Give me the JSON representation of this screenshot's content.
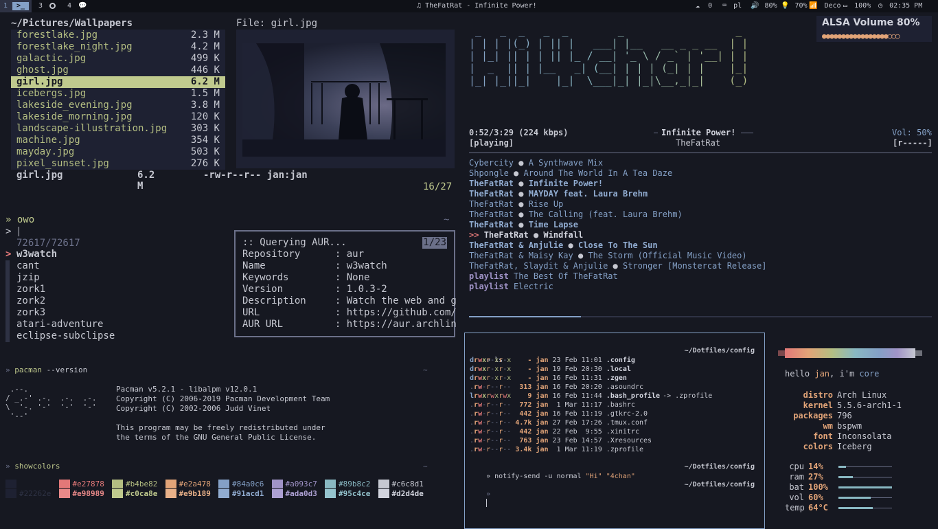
{
  "topbar": {
    "ws2": "3",
    "ws3": "4",
    "now_playing": "TheFatRat - Infinite Power!",
    "status": {
      "updates": "0",
      "lang": "pl",
      "volume": "80%",
      "brightness": "70%",
      "wifi": "Deco",
      "battery": "100%",
      "time": "02:35 PM"
    }
  },
  "ranger": {
    "path": "~/Pictures/Wallpapers",
    "files": [
      {
        "name": "forestlake.jpg",
        "size": "2.3 M"
      },
      {
        "name": "forestlake_night.jpg",
        "size": "4.2 M"
      },
      {
        "name": "galactic.jpg",
        "size": "499 K"
      },
      {
        "name": "ghost.jpg",
        "size": "446 K"
      },
      {
        "name": "girl.jpg",
        "size": "6.2 M"
      },
      {
        "name": "icebergs.jpg",
        "size": "1.5 M"
      },
      {
        "name": "lakeside_evening.jpg",
        "size": "3.8 M"
      },
      {
        "name": "lakeside_morning.jpg",
        "size": "120 K"
      },
      {
        "name": "landscape-illustration.jpg",
        "size": "303 K"
      },
      {
        "name": "machine.jpg",
        "size": "354 K"
      },
      {
        "name": "mayday.jpg",
        "size": "503 K"
      },
      {
        "name": "pixel_sunset.jpg",
        "size": "276 K"
      }
    ],
    "selected_index": 4,
    "preview_title": "File: girl.jpg",
    "status_name": "girl.jpg",
    "status_size": "6.2 M",
    "status_perm": "-rw-r--r-- jan:jan",
    "count": "16/27"
  },
  "search": {
    "prompt": "» owo",
    "tilde": "~",
    "input_prompt": ">",
    "count": "72617/72617",
    "results": [
      "w3watch",
      "cant",
      "jzip",
      "zork1",
      "zork2",
      "zork3",
      "atari-adventure",
      "eclipse-subclipse"
    ],
    "aur": {
      "counter": "1/23",
      "lines": [
        ":: Querying AUR...",
        "Repository      : aur",
        "Name            : w3watch",
        "Keywords        : None",
        "Version         : 1.0.3-2",
        "Description     : Watch the web and g",
        "URL             : https://github.com/",
        "AUR URL         : https://aur.archlin"
      ]
    }
  },
  "pacman": {
    "cmd_prompt": "»",
    "cmd": "pacman",
    "cmd_arg": "--version",
    "tilde": "~",
    "art": " .--.\n/ _.-' .-.  .-.  .-.\n\\  '-. '-'  '-'  '-'\n '--'",
    "lines": [
      "Pacman v5.2.1 - libalpm v12.0.1",
      "Copyright (C) 2006-2019 Pacman Development Team",
      "Copyright (C) 2002-2006 Judd Vinet"
    ],
    "legal": [
      "This program may be freely redistributed under",
      "the terms of the GNU General Public License."
    ]
  },
  "showcolors": {
    "cmd_prompt": "»",
    "cmd": "showcolors",
    "tilde": "~",
    "pairs": [
      {
        "a": "#22262e",
        "b": "",
        "ca": "#1e2132",
        "cb": "#1e2132"
      },
      {
        "a": "#e27878",
        "b": "#e98989",
        "ca": "#e27878",
        "cb": "#e98989"
      },
      {
        "a": "#b4be82",
        "b": "#c0ca8e",
        "ca": "#b4be82",
        "cb": "#c0ca8e"
      },
      {
        "a": "#e2a478",
        "b": "#e9b189",
        "ca": "#e2a478",
        "cb": "#e9b189"
      },
      {
        "a": "#84a0c6",
        "b": "#91acd1",
        "ca": "#84a0c6",
        "cb": "#91acd1"
      },
      {
        "a": "#a093c7",
        "b": "#ada0d3",
        "ca": "#a093c7",
        "cb": "#ada0d3"
      },
      {
        "a": "#89b8c2",
        "b": "#95c4ce",
        "ca": "#89b8c2",
        "cb": "#95c4ce"
      },
      {
        "a": "#c6c8d1",
        "b": "#d2d4de",
        "ca": "#c6c8d1",
        "cb": "#d2d4de"
      }
    ]
  },
  "ascii_title": " _   _  _   _  _        _                  _\n| | | |(_) | || |   ___| |__   __ _ _ __  | |\n| |_| || | | || |_ / __| '_ \\ / _` | '__| | |\n|  _  || | |__   _| (__| | | | (_| | |    |_|\n|_| |_||_|    |_|  \\___|_| |_|\\__,_|_|    (_)",
  "volume_osd": {
    "title": "ALSA Volume 80%",
    "level": 0.8,
    "dots": "●●●●●●●●●●●●●●●●●○○○"
  },
  "player": {
    "time": "0:52/3:29 (224 kbps)",
    "state": "[playing]",
    "title": "Infinite Power!",
    "artist": "TheFatRat",
    "vol": "Vol: 50%",
    "flags": "[r-----]",
    "progress": 0.25,
    "playlist": [
      {
        "artist": "Cybercity",
        "title": "A Synthwave Mix",
        "bold": false
      },
      {
        "artist": "Shpongle",
        "title": "Around The World In A Tea Daze",
        "bold": false
      },
      {
        "artist": "TheFatRat",
        "title": "Infinite Power!",
        "bold": true
      },
      {
        "artist": "TheFatRat",
        "title": "MAYDAY feat. Laura Brehm",
        "bold": true
      },
      {
        "artist": "TheFatRat",
        "title": "Rise Up",
        "bold": false
      },
      {
        "artist": "TheFatRat",
        "title": "The Calling (feat. Laura Brehm)",
        "bold": false
      },
      {
        "artist": "TheFatRat",
        "title": "Time Lapse",
        "bold": true
      },
      {
        "artist": "TheFatRat",
        "title": "Windfall",
        "bold": true,
        "current": true
      },
      {
        "artist": "TheFatRat & Anjulie",
        "title": "Close To The Sun",
        "bold": true
      },
      {
        "artist": "TheFatRat & Maisy Kay",
        "title": "The Storm (Official Music Video)",
        "bold": false
      },
      {
        "artist": "TheFatRat, Slaydit & Anjulie",
        "title": "Stronger [Monstercat Release]",
        "bold": false
      },
      {
        "artist": "playlist",
        "title": "The Best Of TheFatRat",
        "bold": false,
        "kw": true
      },
      {
        "artist": "playlist",
        "title": "Electric",
        "bold": false,
        "kw": true
      }
    ]
  },
  "terminal": {
    "cwd": "~/Dotfiles/config",
    "ls_prompt": "» ls",
    "entries": [
      {
        "perm": "drwxr-xr-x",
        "size": "-",
        "user": "jan",
        "date": "23 Feb 11:01",
        "name": ".config",
        "dir": true
      },
      {
        "perm": "drwxr-xr-x",
        "size": "-",
        "user": "jan",
        "date": "19 Feb 20:30",
        "name": ".local",
        "dir": true
      },
      {
        "perm": "drwxr-xr-x",
        "size": "-",
        "user": "jan",
        "date": "16 Feb 11:31",
        "name": ".zgen",
        "dir": true
      },
      {
        "perm": ".rw-r--r--",
        "size": "313",
        "user": "jan",
        "date": "16 Feb 20:20",
        "name": ".asoundrc",
        "dir": false
      },
      {
        "perm": "lrwxrwxrwx",
        "size": "9",
        "user": "jan",
        "date": "16 Feb 11:44",
        "name": ".bash_profile",
        "dir": true,
        "link": "-> .zprofile"
      },
      {
        "perm": ".rw-r--r--",
        "size": "772",
        "user": "jan",
        "date": " 1 Mar 11:17",
        "name": ".bashrc",
        "dir": false
      },
      {
        "perm": ".rw-r--r--",
        "size": "442",
        "user": "jan",
        "date": "16 Feb 11:19",
        "name": ".gtkrc-2.0",
        "dir": false
      },
      {
        "perm": ".rw-r--r--",
        "size": "4.7k",
        "user": "jan",
        "date": "27 Feb 17:26",
        "name": ".tmux.conf",
        "dir": false
      },
      {
        "perm": ".rw-r--r--",
        "size": "442",
        "user": "jan",
        "date": "22 Feb  9:55",
        "name": ".xinitrc",
        "dir": false
      },
      {
        "perm": ".rw-r--r--",
        "size": "763",
        "user": "jan",
        "date": "23 Feb 14:57",
        "name": ".Xresources",
        "dir": false
      },
      {
        "perm": ".rw-r--r--",
        "size": "3.4k",
        "user": "jan",
        "date": " 1 Mar 11:19",
        "name": ".zprofile",
        "dir": false
      }
    ],
    "notify_cmd": "» notify-send",
    "notify_args": " -u normal ",
    "notify_str": "\"Hi\" \"4chan\"",
    "empty_prompt": "»"
  },
  "neofetch": {
    "hello_prefix": "hello ",
    "user": "jan",
    "hello_mid": ", i'm ",
    "host": "core",
    "info": [
      {
        "k": "distro",
        "v": "Arch Linux"
      },
      {
        "k": "kernel",
        "v": "5.5.6-arch1-1"
      },
      {
        "k": "packages",
        "v": "796"
      },
      {
        "k": "wm",
        "v": "bspwm"
      },
      {
        "k": "font",
        "v": "Inconsolata"
      },
      {
        "k": "colors",
        "v": "Iceberg"
      }
    ],
    "stats": [
      {
        "k": "cpu",
        "v": "14%",
        "level": 0.14
      },
      {
        "k": "ram",
        "v": "27%",
        "level": 0.27
      },
      {
        "k": "bat",
        "v": "100%",
        "level": 1.0
      },
      {
        "k": "vol",
        "v": "60%",
        "level": 0.6
      },
      {
        "k": "temp",
        "v": "64°C",
        "level": 0.64
      }
    ]
  }
}
